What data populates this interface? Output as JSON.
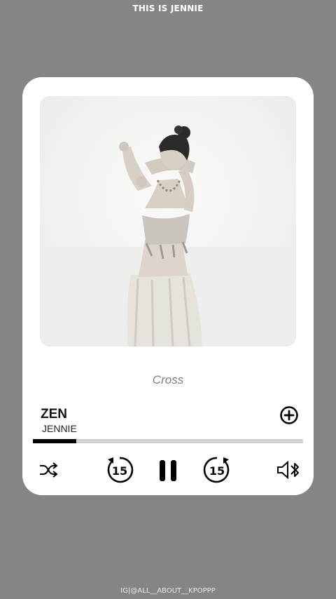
{
  "header": {
    "title": "THIS IS JENNIE"
  },
  "player": {
    "lyric": "Cross",
    "track": {
      "title": "ZEN",
      "artist": "JENNIE"
    },
    "progress": 0.16,
    "skip_back_seconds": "15",
    "skip_forward_seconds": "15"
  },
  "footer": {
    "credit": "IG|@ALL__ABOUT__KPOPPP"
  },
  "icons": {
    "add": "add-circle-icon",
    "shuffle": "shuffle-icon",
    "rewind": "rewind-15-icon",
    "pause": "pause-icon",
    "forward": "forward-15-icon",
    "volume": "speaker-bluetooth-icon"
  },
  "colors": {
    "background": "#858585",
    "card": "#ffffff",
    "progress": "#000000",
    "track": "#d2d2d2"
  }
}
